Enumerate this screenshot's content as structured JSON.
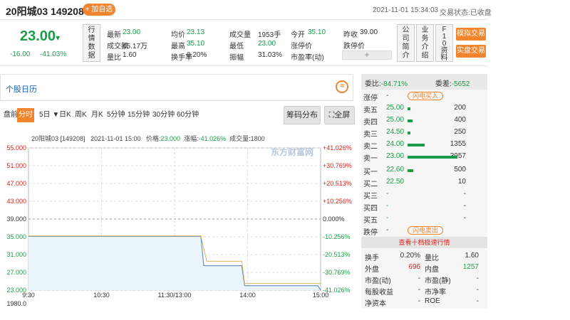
{
  "header": {
    "title": "20阳城03 149208",
    "add_label": "+ 加自选",
    "datetime": "2021-11-01 15:34:03",
    "status": "交易状态:已收盘"
  },
  "quote": {
    "price": "23.00",
    "arrow": "▾",
    "change": "-16.00",
    "change_pct": "-41.03%",
    "vertical_label": [
      "行",
      "情",
      "数",
      "据"
    ],
    "fields": [
      {
        "label": "最新",
        "value": "23.00",
        "tone": "g"
      },
      {
        "label": "成交额",
        "value": "45.17万",
        "tone": "k"
      },
      {
        "label": "量比",
        "value": "1.60",
        "tone": "k"
      },
      {
        "label": "均价",
        "value": "23.13",
        "tone": "g"
      },
      {
        "label": "最高",
        "value": "35.10",
        "tone": "g"
      },
      {
        "label": "换手率",
        "value": "0.20%",
        "tone": "k"
      },
      {
        "label": "成交量",
        "value": "1953手",
        "tone": "k"
      },
      {
        "label": "最低",
        "value": "23.00",
        "tone": "g"
      },
      {
        "label": "振幅",
        "value": "31.03%",
        "tone": "k"
      },
      {
        "label": "今开",
        "value": "35.10",
        "tone": "g"
      },
      {
        "label": "涨停价",
        "value": "-",
        "tone": "k"
      },
      {
        "label": "市盈率(动)",
        "value": "-",
        "tone": "k"
      },
      {
        "label": "昨收",
        "value": "39.00",
        "tone": "k"
      },
      {
        "label": "跌停价",
        "value": "-",
        "tone": "k"
      }
    ],
    "plus": "+",
    "side_boxes": [
      [
        "公",
        "司",
        "简",
        "介"
      ],
      [
        "业",
        "务",
        "介",
        "绍"
      ],
      [
        "F",
        "1",
        "0",
        "资",
        "料"
      ]
    ],
    "sim_trade": "模拟交易",
    "real_trade": "实盘交易"
  },
  "calendar": {
    "label": "个股日历",
    "toggle": "≈"
  },
  "tabs": [
    "盘前",
    "分时",
    "5日 ▼",
    "日K",
    "周K",
    "月K",
    "5分钟",
    "15分钟",
    "30分钟",
    "60分钟"
  ],
  "active_tab": 1,
  "chart_buttons": {
    "chip": "筹码分布",
    "fullscreen": "全屏"
  },
  "chart_info": {
    "name": "20阳城03 [149208]",
    "time": "2021-11-01 15:00",
    "price_label": "价格:",
    "price": "23.000",
    "chg_label": "涨幅:",
    "chg": "-41.026%",
    "vol_label": "成交量:",
    "vol": "1800"
  },
  "watermark": "东方财富网",
  "chart_data": {
    "type": "line",
    "x_ticks": [
      "9:30",
      "10:30",
      "11:30/13:00",
      "14:00",
      "15:00"
    ],
    "y_ticks_left": [
      "55.000",
      "51.000",
      "47.000",
      "43.000",
      "39.000",
      "35.000",
      "31.000",
      "27.000",
      "23.000"
    ],
    "y_ticks_right": [
      "+41.026%",
      "+30.769%",
      "+20.513%",
      "+10.256%",
      "0.000%",
      "-10.256%",
      "-20.513%",
      "-30.769%",
      "-41.026%"
    ],
    "volume_label": "1980.0",
    "ylim": [
      23,
      55
    ],
    "prev_close": 39,
    "series": [
      {
        "values_x": [
          0,
          0.59,
          0.6,
          0.73,
          0.74,
          0.99,
          1.0
        ],
        "values": [
          35.1,
          35.1,
          28.5,
          28.5,
          24.0,
          24.0,
          23.0
        ]
      },
      {
        "values_x": [
          0,
          0.59,
          0.61,
          0.73,
          0.74,
          1.0
        ],
        "values": [
          35.2,
          35.2,
          29.5,
          29.5,
          24.5,
          24.5
        ]
      }
    ],
    "colors": {
      "price": "#4b7fb8",
      "avg": "#e0b35c",
      "fill": "#eaf4fb"
    }
  },
  "orderbook": {
    "wb_label": "委比:",
    "wb_value": "-84.71%",
    "wc_label": "委差:",
    "wc_value": "-5652",
    "limit_up_label": "涨停",
    "limit_up_value": "-",
    "flash_buy": "闪电买入",
    "asks": [
      {
        "label": "卖五",
        "price": "25.00",
        "vol": "200",
        "bar": 0.05
      },
      {
        "label": "卖四",
        "price": "25.00",
        "vol": "400",
        "bar": 0.1
      },
      {
        "label": "卖三",
        "price": "24.50",
        "vol": "250",
        "bar": 0.06
      },
      {
        "label": "卖二",
        "price": "24.00",
        "vol": "1355",
        "bar": 0.34
      },
      {
        "label": "卖一",
        "price": "23.00",
        "vol": "3957",
        "bar": 1.0
      }
    ],
    "bids": [
      {
        "label": "买一",
        "price": "22.60",
        "vol": "500",
        "bar": 0.12
      },
      {
        "label": "买二",
        "price": "22.50",
        "vol": "10",
        "bar": 0.0
      },
      {
        "label": "买三",
        "price": "-",
        "vol": "-",
        "bar": 0
      },
      {
        "label": "买四",
        "price": "-",
        "vol": "-",
        "bar": 0
      },
      {
        "label": "买五",
        "price": "-",
        "vol": "-",
        "bar": 0
      }
    ],
    "limit_down_label": "跌停",
    "limit_down_value": "-",
    "flash_sell": "闪电卖出",
    "more": "查看十档极速行情"
  },
  "stats": [
    {
      "l1": "换手",
      "v1": "0.20%",
      "l2": "量比",
      "v2": "1.60",
      "c1": "#333",
      "c2": "#333"
    },
    {
      "l1": "外盘",
      "v1": "696",
      "l2": "内盘",
      "v2": "1257",
      "c1": "#d9251d",
      "c2": "#1c9c4a"
    },
    {
      "l1": "市盈(动)",
      "v1": "-",
      "l2": "市盈(静)",
      "v2": "-",
      "c1": "#333",
      "c2": "#333"
    },
    {
      "l1": "每股收益",
      "v1": "-",
      "l2": "市净率",
      "v2": "-",
      "c1": "#333",
      "c2": "#333"
    },
    {
      "l1": "净资本",
      "v1": "-",
      "l2": "ROE",
      "v2": "-",
      "c1": "#333",
      "c2": "#333"
    }
  ]
}
